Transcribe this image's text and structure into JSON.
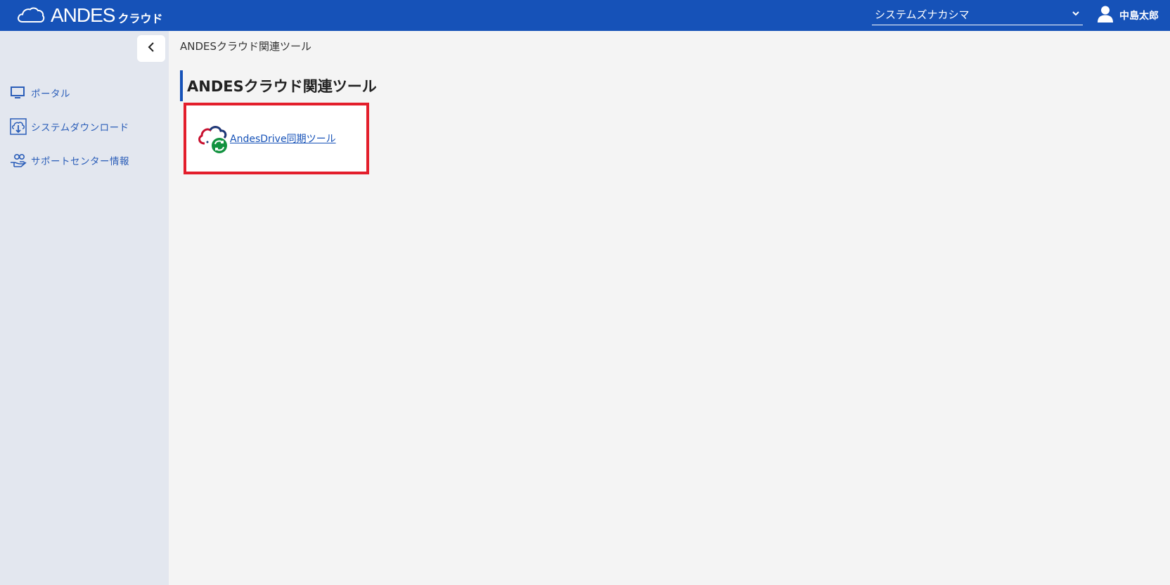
{
  "header": {
    "brand_name": "ANDES",
    "brand_sub": "クラウド",
    "org_select": {
      "value": "システムズナカシマ",
      "chevron_icon": "chevron-down-icon"
    },
    "user_name": "中島太郎",
    "user_icon": "user-icon",
    "bg_color": "#1652b8"
  },
  "sidebar": {
    "collapse_icon": "chevron-left-icon",
    "items": [
      {
        "label": "ポータル",
        "icon": "monitor-icon"
      },
      {
        "label": "システムダウンロード",
        "icon": "cloud-download-icon"
      },
      {
        "label": "サポートセンター情報",
        "icon": "support-hand-icon"
      }
    ]
  },
  "main": {
    "breadcrumb": "ANDESクラウド関連ツール",
    "title": "ANDESクラウド関連ツール",
    "tools": [
      {
        "label": "AndesDrive同期ツール",
        "icon": "andesdrive-sync-icon"
      }
    ]
  },
  "colors": {
    "accent": "#1652b8",
    "highlight": "#e31e2b",
    "sidebar_bg": "#e3e7ef",
    "page_bg": "#f4f4f4"
  }
}
